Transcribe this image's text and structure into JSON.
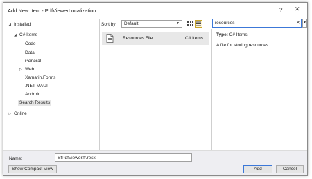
{
  "window": {
    "title": "Add New Item - PdfViewerLocalization",
    "help_label": "?",
    "close_label": "✕"
  },
  "tree": {
    "installed": "Installed",
    "csharp_items": "C# Items",
    "code": "Code",
    "data": "Data",
    "general": "General",
    "web": "Web",
    "xamarin_forms": "Xamarin.Forms",
    "net_maui": ".NET MAUI",
    "android": "Android",
    "search_results": "Search Results",
    "online": "Online"
  },
  "sort": {
    "label": "Sort by:",
    "value": "Default"
  },
  "search": {
    "value": "resources",
    "clear_label": "✕"
  },
  "items": [
    {
      "name": "Resources File",
      "type": "C# Items"
    }
  ],
  "detail": {
    "type_key": "Type:",
    "type_value": "C# Items",
    "description": "A file for storing resources"
  },
  "footer": {
    "name_label": "Name:",
    "name_value": "SfPdfViewer.fr.resx",
    "compact_view_label": "Show Compact View",
    "add_label": "Add",
    "cancel_label": "Cancel"
  },
  "colors": {
    "accent": "#3c78d8",
    "selection": "#e8e8e8",
    "footer_bg": "#eeeef2"
  }
}
